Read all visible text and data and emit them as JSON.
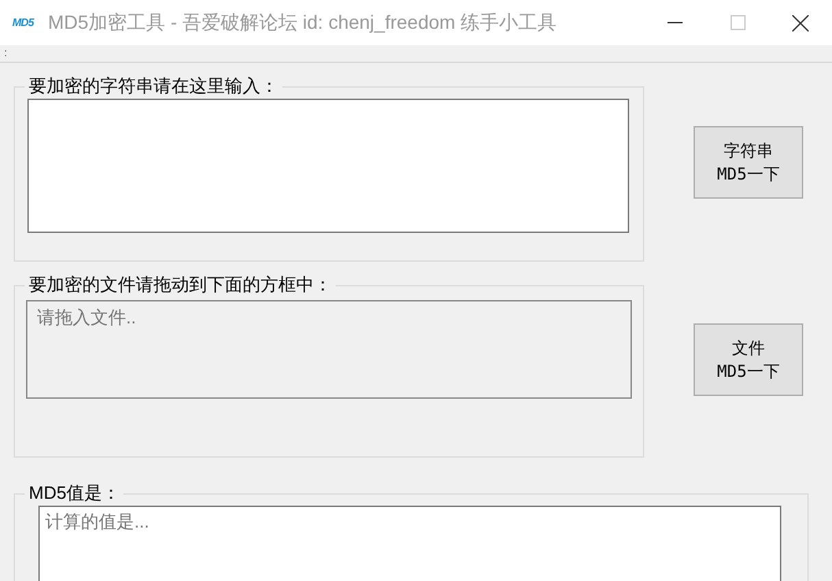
{
  "window": {
    "icon_text": "MD5",
    "title": "MD5加密工具 - 吾爱破解论坛 id: chenj_freedom 练手小工具",
    "maximize_disabled": true
  },
  "strip": {
    "text": ":"
  },
  "string_group": {
    "legend": "要加密的字符串请在这里输入：",
    "button_lines": [
      "字符串",
      "MD5一下"
    ]
  },
  "file_group": {
    "legend": "要加密的文件请拖动到下面的方框中：",
    "placeholder": "请拖入文件..",
    "button_lines": [
      "文件",
      "MD5一下"
    ]
  },
  "result_group": {
    "legend": "MD5值是：",
    "placeholder": "计算的值是..."
  }
}
